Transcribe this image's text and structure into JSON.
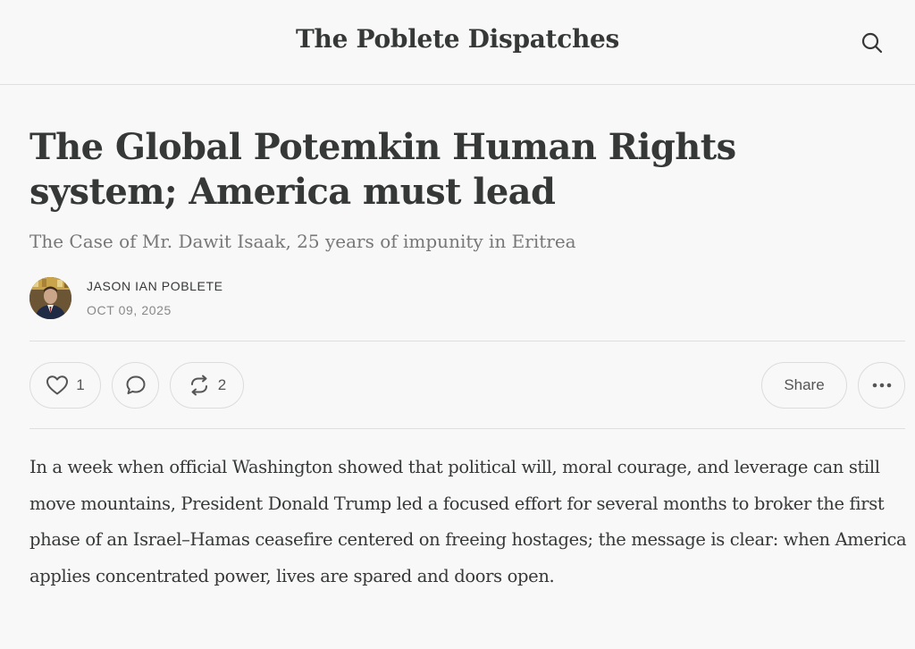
{
  "header": {
    "publication": "The Poblete Dispatches",
    "search_icon": "search-icon"
  },
  "post": {
    "title": "The Global Potemkin Human Rights system; America must lead",
    "subtitle": "The Case of Mr. Dawit Isaak, 25 years of impunity in Eritrea",
    "author": "JASON IAN POBLETE",
    "date": "OCT 09, 2025"
  },
  "actions": {
    "like_count": "1",
    "restack_count": "2",
    "share_label": "Share",
    "icons": {
      "like": "heart-icon",
      "comment": "comment-bubble-icon",
      "restack": "restack-icon",
      "more": "more-dots-icon"
    }
  },
  "body": {
    "paragraph": "In a week when official Washington showed that political will, moral courage, and leverage can still move mountains, President Donald Trump led a focused effort for several months to broker the first phase of an Israel–Hamas ceasefire centered on freeing hostages; the message is clear: when America applies concentrated power, lives are spared and doors open."
  }
}
